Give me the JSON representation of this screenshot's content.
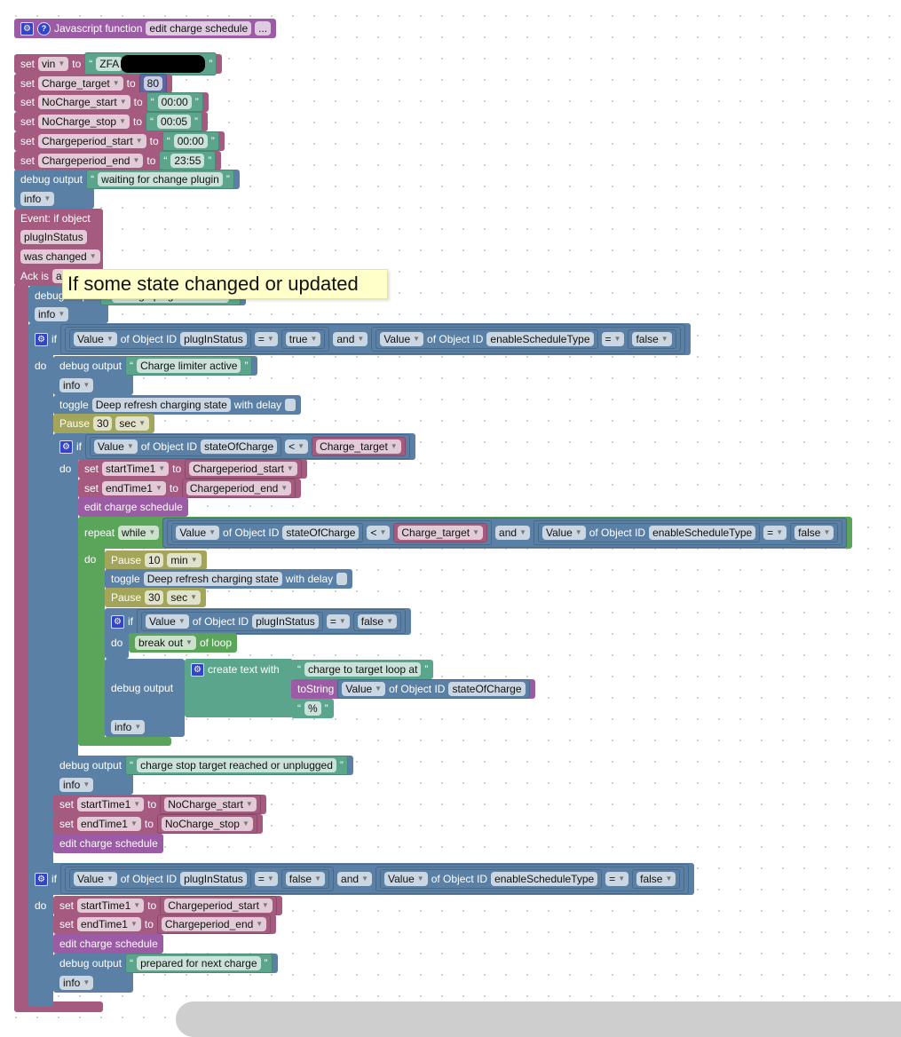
{
  "colors": {
    "proc": "#9b5ba5",
    "var": "#a55b80",
    "text": "#5ba58c",
    "number": "#5b67a5",
    "debug": "#5b80a5",
    "logic": "#5b80a5",
    "pause": "#a3a55b",
    "loop": "#5ba55b",
    "event": "#a55b80",
    "tostring": "#9b5ba5",
    "icon": "#3344cc"
  },
  "rows": {
    "header": [
      {
        "icon": "gear"
      },
      {
        "icon": "help"
      },
      "Javascript function",
      {
        "f": "edit charge schedule"
      },
      {
        "f": "..."
      }
    ],
    "set_vin": [
      "set",
      {
        "f": "vin",
        "dd": true
      },
      "to",
      {
        "b": "text",
        "items": [
          "“",
          {
            "f": "ZFA"
          },
          {
            "redacted": true
          },
          "”"
        ]
      }
    ],
    "set_ct": [
      "set",
      {
        "f": "Charge_target",
        "dd": true
      },
      "to",
      {
        "b": "number",
        "items": [
          {
            "f": "80"
          }
        ]
      }
    ],
    "set_ncs": [
      "set",
      {
        "f": "NoCharge_start",
        "dd": true
      },
      "to",
      {
        "b": "text",
        "items": [
          "“",
          {
            "f": "00:00"
          },
          "”"
        ]
      }
    ],
    "set_nce": [
      "set",
      {
        "f": "NoCharge_stop",
        "dd": true
      },
      "to",
      {
        "b": "text",
        "items": [
          "“",
          {
            "f": "00:05"
          },
          "”"
        ]
      }
    ],
    "set_cps": [
      "set",
      {
        "f": "Chargeperiod_start",
        "dd": true
      },
      "to",
      {
        "b": "text",
        "items": [
          "“",
          {
            "f": "00:00"
          },
          "”"
        ]
      }
    ],
    "set_cpe": [
      "set",
      {
        "f": "Chargeperiod_end",
        "dd": true
      },
      "to",
      {
        "b": "text",
        "items": [
          "“",
          {
            "f": "23:55"
          },
          "”"
        ]
      }
    ],
    "dbg1": [
      "debug output",
      {
        "b": "text",
        "items": [
          "“",
          {
            "f": "waiting for change plugin"
          },
          "”"
        ]
      }
    ],
    "dbg1_lvl": [
      {
        "f": "info",
        "dd": true
      }
    ],
    "ev1": [
      "Event: if object"
    ],
    "ev2": [
      {
        "f": "plugInStatus"
      }
    ],
    "ev3": [
      {
        "f": "was changed",
        "dd": true
      }
    ],
    "ev4": [
      "Ack is",
      {
        "f": "a"
      }
    ],
    "dbg2": [
      "debug output",
      {
        "b": "text",
        "items": [
          "“",
          {
            "f": "change plugin detected"
          },
          "”"
        ]
      }
    ],
    "dbg2_lvl": [
      {
        "f": "info",
        "dd": true
      }
    ],
    "if1": [
      {
        "icon": "gear"
      },
      "if",
      {
        "b": "logic",
        "items": [
          {
            "b": "logic",
            "items": [
              {
                "b": "logic",
                "items": [
                  {
                    "f": "Value",
                    "dd": true
                  },
                  "of Object ID",
                  {
                    "f": "plugInStatus"
                  }
                ]
              },
              {
                "f": "=",
                "dd": true
              },
              {
                "b": "logic",
                "items": [
                  {
                    "f": "true",
                    "dd": true
                  }
                ]
              }
            ]
          },
          {
            "f": "and",
            "dd": true
          },
          {
            "b": "logic",
            "items": [
              {
                "b": "logic",
                "items": [
                  {
                    "f": "Value",
                    "dd": true
                  },
                  "of Object ID",
                  {
                    "f": "enableScheduleType"
                  }
                ]
              },
              {
                "f": "=",
                "dd": true
              },
              {
                "b": "logic",
                "items": [
                  {
                    "f": "false",
                    "dd": true
                  }
                ]
              }
            ]
          }
        ]
      }
    ],
    "do1": [
      "do"
    ],
    "dbg3": [
      "debug output",
      {
        "b": "text",
        "items": [
          "“",
          {
            "f": "Charge limiter active"
          },
          "”"
        ]
      }
    ],
    "dbg3_lvl": [
      {
        "f": "info",
        "dd": true
      }
    ],
    "toggle1": [
      "toggle",
      {
        "f": "Deep refresh charging state"
      },
      "with delay",
      {
        "check": true
      }
    ],
    "pause1": [
      "Pause",
      {
        "f": "30"
      },
      {
        "f": "sec",
        "dd": true
      }
    ],
    "if2": [
      {
        "icon": "gear"
      },
      "if",
      {
        "b": "logic",
        "items": [
          {
            "b": "logic",
            "items": [
              {
                "f": "Value",
                "dd": true
              },
              "of Object ID",
              {
                "f": "stateOfCharge"
              }
            ]
          },
          {
            "f": "<",
            "dd": true
          },
          {
            "b": "var",
            "items": [
              {
                "f": "Charge_target",
                "dd": true
              }
            ]
          }
        ]
      }
    ],
    "do2": [
      "do"
    ],
    "set_st1": [
      "set",
      {
        "f": "startTime1",
        "dd": true
      },
      "to",
      {
        "b": "var",
        "items": [
          {
            "f": "Chargeperiod_start",
            "dd": true
          }
        ]
      }
    ],
    "set_et1": [
      "set",
      {
        "f": "endTime1",
        "dd": true
      },
      "to",
      {
        "b": "var",
        "items": [
          {
            "f": "Chargeperiod_end",
            "dd": true
          }
        ]
      }
    ],
    "call1": [
      "edit charge schedule"
    ],
    "repeat": [
      "repeat",
      {
        "f": "while",
        "dd": true
      },
      {
        "b": "logic",
        "items": [
          {
            "b": "logic",
            "items": [
              {
                "b": "logic",
                "items": [
                  {
                    "f": "Value",
                    "dd": true
                  },
                  "of Object ID",
                  {
                    "f": "stateOfCharge"
                  }
                ]
              },
              {
                "f": "<",
                "dd": true
              },
              {
                "b": "var",
                "items": [
                  {
                    "f": "Charge_target",
                    "dd": true
                  }
                ]
              }
            ]
          },
          {
            "f": "and",
            "dd": true
          },
          {
            "b": "logic",
            "items": [
              {
                "b": "logic",
                "items": [
                  {
                    "f": "Value",
                    "dd": true
                  },
                  "of Object ID",
                  {
                    "f": "enableScheduleType"
                  }
                ]
              },
              {
                "f": "=",
                "dd": true
              },
              {
                "b": "logic",
                "items": [
                  {
                    "f": "false",
                    "dd": true
                  }
                ]
              }
            ]
          }
        ]
      }
    ],
    "do3": [
      "do"
    ],
    "pause2": [
      "Pause",
      {
        "f": "10"
      },
      {
        "f": "min",
        "dd": true
      }
    ],
    "toggle2": [
      "toggle",
      {
        "f": "Deep refresh charging state"
      },
      "with delay",
      {
        "check": true
      }
    ],
    "pause3": [
      "Pause",
      {
        "f": "30"
      },
      {
        "f": "sec",
        "dd": true
      }
    ],
    "if3": [
      {
        "icon": "gear"
      },
      "if",
      {
        "b": "logic",
        "items": [
          {
            "b": "logic",
            "items": [
              {
                "f": "Value",
                "dd": true
              },
              "of Object ID",
              {
                "f": "plugInStatus"
              }
            ]
          },
          {
            "f": "=",
            "dd": true
          },
          {
            "b": "logic",
            "items": [
              {
                "f": "false",
                "dd": true
              }
            ]
          }
        ]
      }
    ],
    "do4": [
      "do"
    ],
    "brk": [
      {
        "f": "break out",
        "dd": true
      },
      "of loop"
    ],
    "dbg4": [
      "debug output"
    ],
    "ctext": [
      {
        "icon": "gear"
      },
      "create text with"
    ],
    "ctext1": [
      "“",
      {
        "f": "charge to target loop at"
      },
      "”"
    ],
    "ctext2": [
      "toString",
      {
        "b": "logic",
        "items": [
          {
            "f": "Value",
            "dd": true
          },
          "of Object ID",
          {
            "f": "stateOfCharge"
          }
        ]
      }
    ],
    "ctext3": [
      "“",
      {
        "f": "%"
      },
      "”"
    ],
    "dbg4_lvl": [
      {
        "f": "info",
        "dd": true
      }
    ],
    "dbg5": [
      "debug output",
      {
        "b": "text",
        "items": [
          "“",
          {
            "f": "charge stop target reached or unplugged"
          },
          "”"
        ]
      }
    ],
    "dbg5_lvl": [
      {
        "f": "info",
        "dd": true
      }
    ],
    "set_st2": [
      "set",
      {
        "f": "startTime1",
        "dd": true
      },
      "to",
      {
        "b": "var",
        "items": [
          {
            "f": "NoCharge_start",
            "dd": true
          }
        ]
      }
    ],
    "set_et2": [
      "set",
      {
        "f": "endTime1",
        "dd": true
      },
      "to",
      {
        "b": "var",
        "items": [
          {
            "f": "NoCharge_stop",
            "dd": true
          }
        ]
      }
    ],
    "call2": [
      "edit charge schedule"
    ],
    "if4": [
      {
        "icon": "gear"
      },
      "if",
      {
        "b": "logic",
        "items": [
          {
            "b": "logic",
            "items": [
              {
                "b": "logic",
                "items": [
                  {
                    "f": "Value",
                    "dd": true
                  },
                  "of Object ID",
                  {
                    "f": "plugInStatus"
                  }
                ]
              },
              {
                "f": "=",
                "dd": true
              },
              {
                "b": "logic",
                "items": [
                  {
                    "f": "false",
                    "dd": true
                  }
                ]
              }
            ]
          },
          {
            "f": "and",
            "dd": true
          },
          {
            "b": "logic",
            "items": [
              {
                "b": "logic",
                "items": [
                  {
                    "f": "Value",
                    "dd": true
                  },
                  "of Object ID",
                  {
                    "f": "enableScheduleType"
                  }
                ]
              },
              {
                "f": "=",
                "dd": true
              },
              {
                "b": "logic",
                "items": [
                  {
                    "f": "false",
                    "dd": true
                  }
                ]
              }
            ]
          }
        ]
      }
    ],
    "do5": [
      "do"
    ],
    "set_st3": [
      "set",
      {
        "f": "startTime1",
        "dd": true
      },
      "to",
      {
        "b": "var",
        "items": [
          {
            "f": "Chargeperiod_start",
            "dd": true
          }
        ]
      }
    ],
    "set_et3": [
      "set",
      {
        "f": "endTime1",
        "dd": true
      },
      "to",
      {
        "b": "var",
        "items": [
          {
            "f": "Chargeperiod_end",
            "dd": true
          }
        ]
      }
    ],
    "call3": [
      "edit charge schedule"
    ],
    "dbg6": [
      "debug output",
      {
        "b": "text",
        "items": [
          "“",
          {
            "f": "prepared for next charge"
          },
          "”"
        ]
      }
    ],
    "dbg6_lvl": [
      {
        "f": "info",
        "dd": true
      }
    ]
  },
  "tooltip": {
    "text": "If some state changed or updated"
  }
}
